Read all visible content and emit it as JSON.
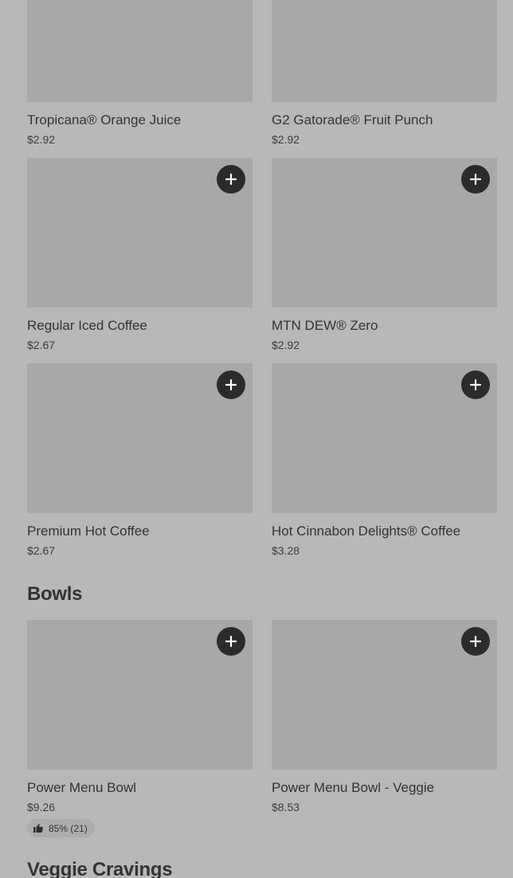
{
  "drinks": [
    {
      "name": "Tropicana® Orange Juice",
      "price": "$2.92"
    },
    {
      "name": "G2 Gatorade® Fruit Punch",
      "price": "$2.92"
    },
    {
      "name": "Regular Iced Coffee",
      "price": "$2.67"
    },
    {
      "name": "MTN DEW® Zero",
      "price": "$2.92"
    },
    {
      "name": "Premium Hot Coffee",
      "price": "$2.67"
    },
    {
      "name": "Hot Cinnabon Delights® Coffee",
      "price": "$3.28"
    }
  ],
  "bowls": {
    "title": "Bowls",
    "items": [
      {
        "name": "Power Menu Bowl",
        "price": "$9.26",
        "rating": "85% (21)"
      },
      {
        "name": "Power Menu Bowl - Veggie",
        "price": "$8.53"
      }
    ]
  },
  "veggie": {
    "title": "Veggie Cravings"
  },
  "icons": {
    "add": "plus-icon",
    "rating": "thumbs-up-icon"
  },
  "colors": {
    "background": "#b8b8b8",
    "image_placeholder": "#a8a8a8",
    "add_button": "#2b2b2b"
  }
}
